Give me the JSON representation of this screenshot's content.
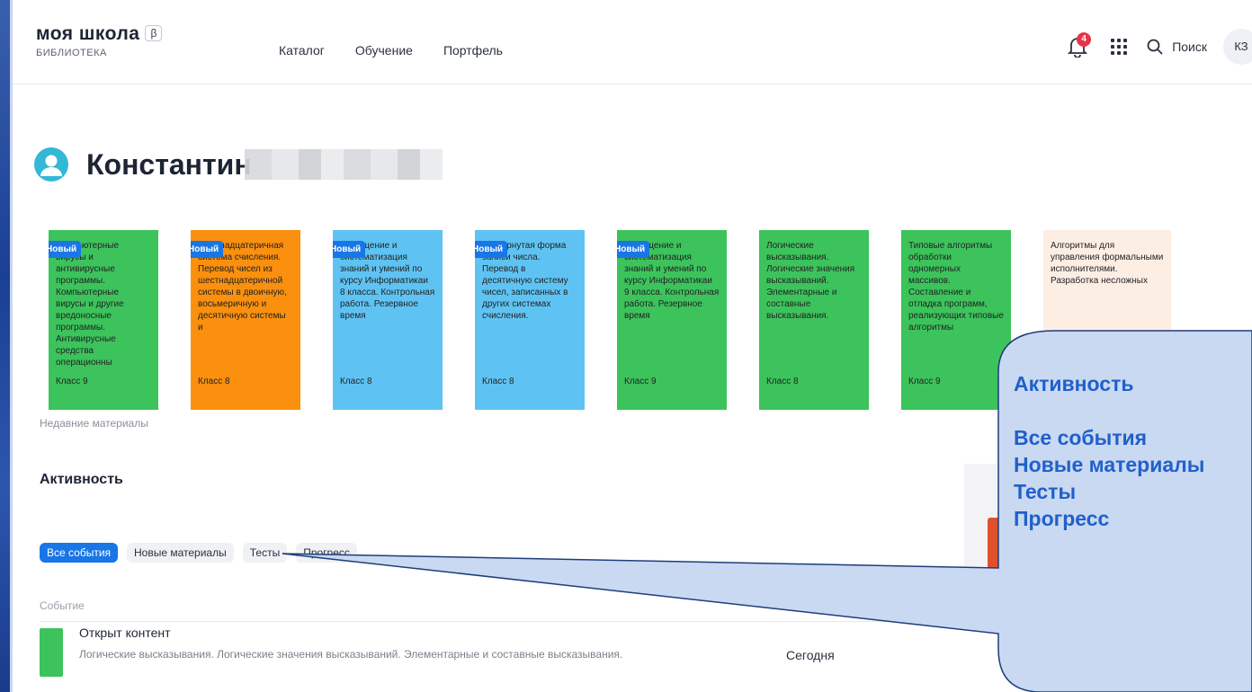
{
  "header": {
    "logo_title": "моя школа",
    "logo_beta": "β",
    "logo_sub": "БИБЛИОТЕКА",
    "nav": [
      "Каталог",
      "Обучение",
      "Портфель"
    ],
    "notifications_count": "4",
    "search_label": "Поиск",
    "user_initials": "КЗ"
  },
  "profile": {
    "name": "Константин"
  },
  "cards": [
    {
      "new": "Новый",
      "text": "Компьютерные вирусы и антивирусные программы. Компьютерные вирусы и другие вредоносные программы. Антивирусные средства операционны",
      "class": "Класс 9",
      "color": "green"
    },
    {
      "new": "Новый",
      "text": "Шестнадцатеричная система счисления. Перевод чисел из шестнадцатеричной системы в двоичную, восьмеричную и десятичную системы и",
      "class": "Класс 8",
      "color": "orange"
    },
    {
      "new": "Новый",
      "text": "Обобщение и систематизация знаний и умений по курсу Информатикаи 8 класса. Контрольная работа. Резервное время",
      "class": "Класс 8",
      "color": "blue"
    },
    {
      "new": "Новый",
      "text": "Развёрнутая форма записи числа. Перевод в десятичную систему чисел, записанных в других системах счисления.",
      "class": "Класс 8",
      "color": "blue"
    },
    {
      "new": "Новый",
      "text": "Обобщение и систематизация знаний и умений по курсу Информатикаи 9 класса. Контрольная работа. Резервное время",
      "class": "Класс 9",
      "color": "green"
    },
    {
      "new": "",
      "text": "Логические высказывания. Логические значения высказываний. Элементарные и составные высказывания.",
      "class": "Класс 8",
      "color": "green"
    },
    {
      "new": "",
      "text": "Типовые алгоритмы обработки одномерных массивов. Составление и отладка программ, реализующих типовые алгоритмы",
      "class": "Класс 9",
      "color": "green"
    },
    {
      "new": "",
      "text": "Алгоритмы для управления формальными исполнителями. Разработка несложных",
      "class": "",
      "color": "peach"
    }
  ],
  "recent_label": "Недавние материалы",
  "activity": {
    "title": "Активность",
    "tabs": [
      "Все события",
      "Новые материалы",
      "Тесты",
      "Прогресс"
    ],
    "column_header": "Событие",
    "event": {
      "title": "Открыт контент",
      "description": "Логические высказывания. Логические значения высказываний. Элементарные и составные высказывания.",
      "date": "Сегодня"
    }
  },
  "callout": {
    "line1": "Активность",
    "line2": "Все события",
    "line3": "Новые материалы",
    "line4": "Тесты",
    "line5": "Прогресс"
  },
  "colors": {
    "accent": "#1976e6",
    "card_green": "#3cc35c",
    "card_orange": "#fa900e",
    "card_blue": "#5ec3f3",
    "card_peach": "#fdeee4",
    "callout_fill": "#c9d9f2",
    "callout_text": "#2160c9"
  }
}
